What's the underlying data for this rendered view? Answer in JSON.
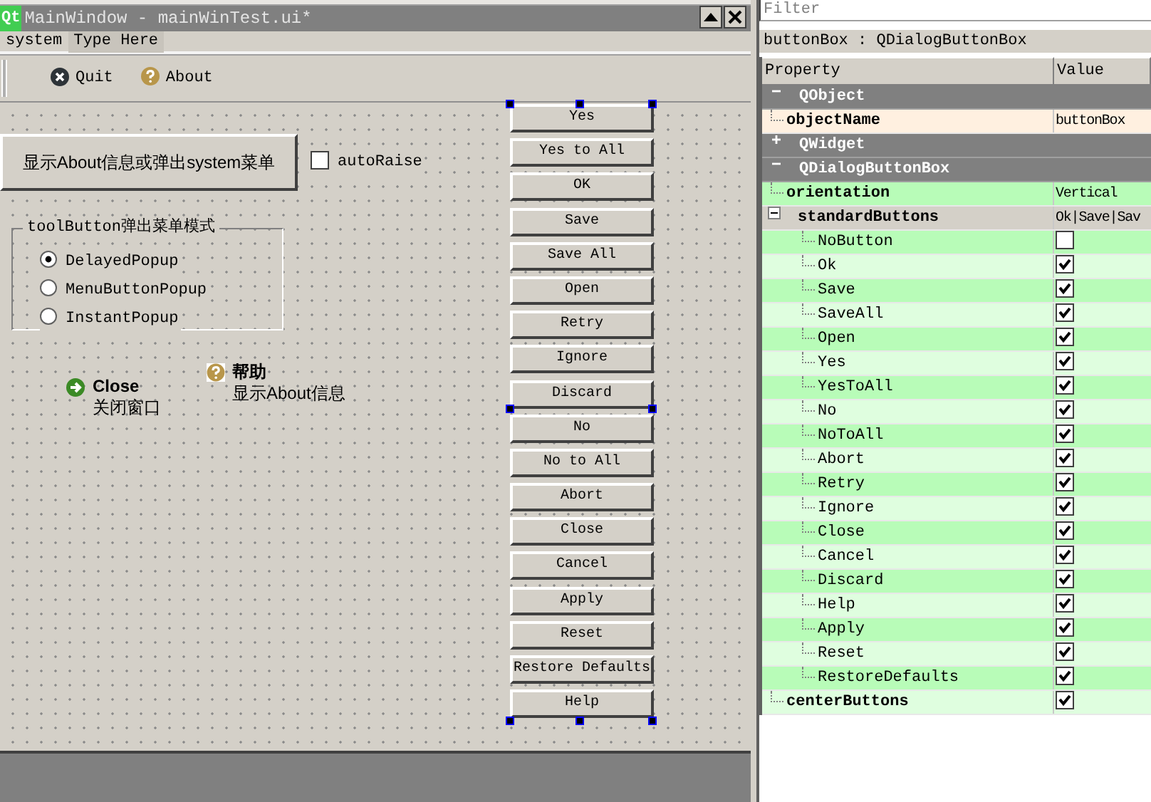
{
  "designer": {
    "logo": "Qt",
    "title": "MainWindow - mainWinTest.ui*",
    "menu": [
      "system",
      "Type Here"
    ],
    "toolbar": [
      {
        "kind": "quit",
        "label": "Quit"
      },
      {
        "kind": "about",
        "label": "About"
      }
    ],
    "main_button": "显示About信息或弹出system菜单",
    "auto_raise": {
      "label": "autoRaise",
      "checked": false
    },
    "group": {
      "title": "toolButton弹出菜单模式",
      "options": [
        {
          "label": "DelayedPopup",
          "selected": true
        },
        {
          "label": "MenuButtonPopup",
          "selected": false
        },
        {
          "label": "InstantPopup",
          "selected": false
        }
      ]
    },
    "tool_buttons": [
      {
        "kind": "arrow",
        "title": "Close",
        "subtitle": "关闭窗口"
      },
      {
        "kind": "help",
        "title": "帮助",
        "subtitle": "显示About信息"
      }
    ],
    "dialog_buttons": [
      "Yes",
      "Yes to All",
      "OK",
      "Save",
      "Save All",
      "Open",
      "Retry",
      "Ignore",
      "Discard",
      "No",
      "No to All",
      "Abort",
      "Close",
      "Cancel",
      "Apply",
      "Reset",
      "Restore Defaults",
      "Help"
    ]
  },
  "property_editor": {
    "filter": {
      "placeholder": "Filter"
    },
    "object_label": "buttonBox : QDialogButtonBox",
    "columns": [
      "Property",
      "Value"
    ],
    "groups": [
      {
        "name": "QObject",
        "expanded": true,
        "color": "#fff0e0",
        "properties": [
          {
            "kind": "text",
            "name": "objectName",
            "value": "buttonBox",
            "selected": false
          }
        ]
      },
      {
        "name": "QWidget",
        "expanded": false
      },
      {
        "name": "QDialogButtonBox",
        "expanded": true,
        "color": "#b8fcb8",
        "properties": [
          {
            "kind": "text",
            "name": "orientation",
            "value": "Vertical",
            "selected": false
          },
          {
            "kind": "flags",
            "name": "standardButtons",
            "value": "Ok|Save|Sav",
            "selected": true,
            "expanded": true,
            "children": [
              {
                "name": "NoButton",
                "checked": false
              },
              {
                "name": "Ok",
                "checked": true
              },
              {
                "name": "Save",
                "checked": true
              },
              {
                "name": "SaveAll",
                "checked": true
              },
              {
                "name": "Open",
                "checked": true
              },
              {
                "name": "Yes",
                "checked": true
              },
              {
                "name": "YesToAll",
                "checked": true
              },
              {
                "name": "No",
                "checked": true
              },
              {
                "name": "NoToAll",
                "checked": true
              },
              {
                "name": "Abort",
                "checked": true
              },
              {
                "name": "Retry",
                "checked": true
              },
              {
                "name": "Ignore",
                "checked": true
              },
              {
                "name": "Close",
                "checked": true
              },
              {
                "name": "Cancel",
                "checked": true
              },
              {
                "name": "Discard",
                "checked": true
              },
              {
                "name": "Help",
                "checked": true
              },
              {
                "name": "Apply",
                "checked": true
              },
              {
                "name": "Reset",
                "checked": true
              },
              {
                "name": "RestoreDefaults",
                "checked": true
              }
            ]
          },
          {
            "kind": "bool",
            "name": "centerButtons",
            "checked": true,
            "selected": false
          }
        ]
      }
    ]
  }
}
